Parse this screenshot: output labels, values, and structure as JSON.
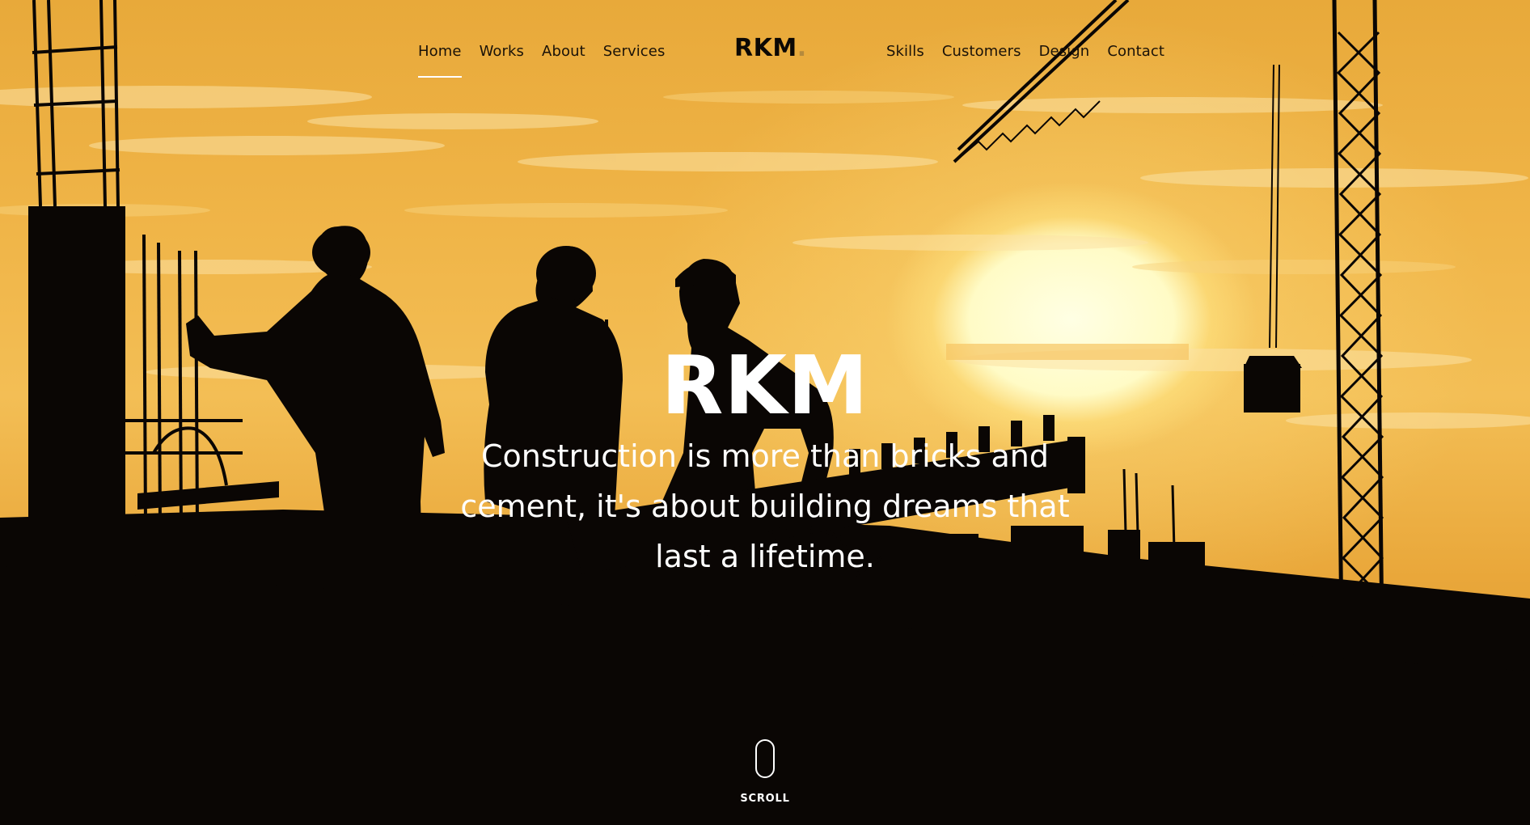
{
  "nav": {
    "left_items": [
      {
        "label": "Home",
        "active": true
      },
      {
        "label": "Works"
      },
      {
        "label": "About"
      },
      {
        "label": "Services"
      }
    ],
    "logo": "RKM",
    "logo_dot": ".",
    "right_items": [
      {
        "label": "Skills"
      },
      {
        "label": "Customers"
      },
      {
        "label": "Design"
      },
      {
        "label": "Contact"
      }
    ]
  },
  "hero": {
    "title": "RKM",
    "tagline": "Construction is more than bricks and cement, it's about building dreams that last a lifetime.",
    "background": "construction-workers-sunset-silhouette"
  },
  "scroll": {
    "label": "SCROLL",
    "icon": "mouse-scroll-icon"
  },
  "colors": {
    "sky": "#f0b548",
    "sun": "#fffbe0",
    "silhouette": "#0a0604",
    "nav_text": "#1a1208",
    "hero_text": "#ffffff",
    "logo_dot": "#b58a3c"
  }
}
